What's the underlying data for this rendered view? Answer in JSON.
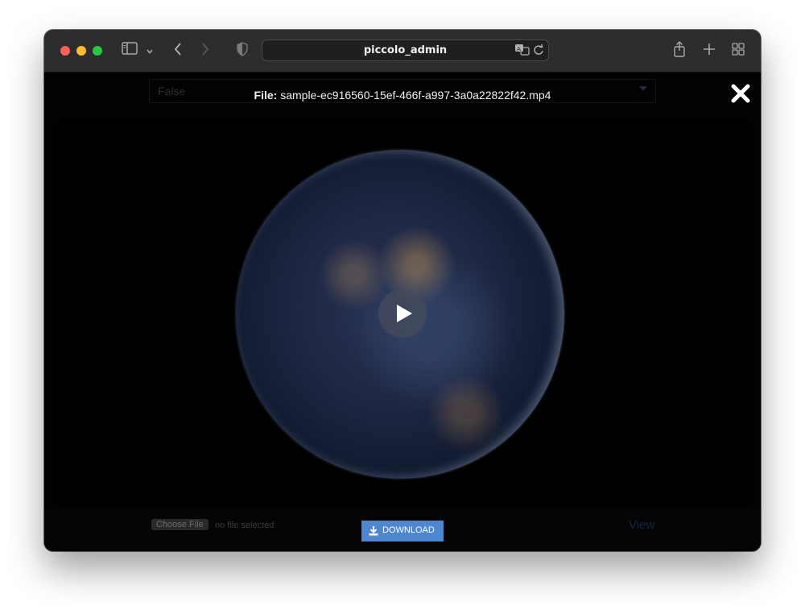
{
  "browser": {
    "url": "piccolo_admin",
    "icons": {
      "sidebar": "sidebar-icon",
      "dropdown": "chevron-down-icon",
      "back": "chevron-left-icon",
      "forward": "chevron-right-icon",
      "privacy": "shield-icon",
      "translate": "translate-icon",
      "reload": "reload-icon",
      "share": "share-icon",
      "new_tab": "plus-icon",
      "tabs": "grid-icon"
    },
    "colors": {
      "close": "#ff5f57",
      "minimize": "#febc2e",
      "zoom": "#28c840"
    }
  },
  "background_page": {
    "select_value": "False",
    "choose_file_label": "Choose File",
    "no_file_text": "no file selected",
    "view_link": "View"
  },
  "modal": {
    "file_label": "File:",
    "file_name": "sample-ec916560-15ef-466f-a997-3a0a22822f42.mp4",
    "close_icon": "close-icon",
    "play_icon": "play-icon",
    "download_label": "DOWNLOAD",
    "download_icon": "download-icon",
    "accent": "#4f86d0"
  }
}
